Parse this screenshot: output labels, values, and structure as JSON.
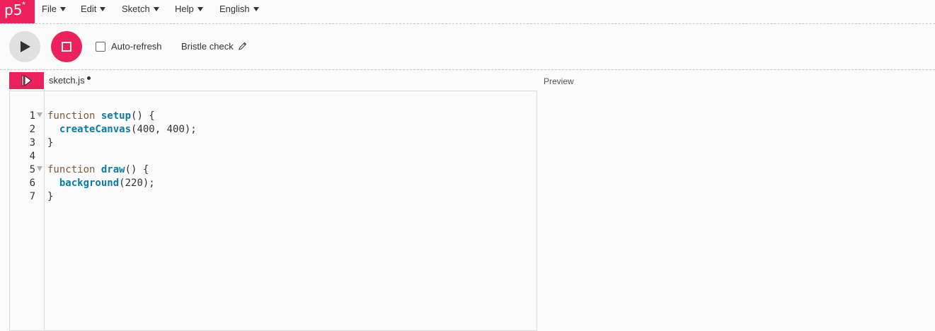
{
  "logo": {
    "text": "p5",
    "mark": "*"
  },
  "menu": [
    {
      "label": "File"
    },
    {
      "label": "Edit"
    },
    {
      "label": "Sketch"
    },
    {
      "label": "Help"
    },
    {
      "label": "English"
    }
  ],
  "toolbar": {
    "auto_refresh_label": "Auto-refresh",
    "auto_refresh_checked": false,
    "sketch_name": "Bristle check"
  },
  "editor": {
    "file_tab": "sketch.js",
    "preview_label": "Preview",
    "lines": [
      {
        "number": "1",
        "keyword": "function ",
        "name": "setup",
        "rest": "() {"
      },
      {
        "number": "2",
        "keyword": "  ",
        "name": "createCanvas",
        "rest": "(400, 400);"
      },
      {
        "number": "3",
        "keyword": "",
        "name": "",
        "rest": "}"
      },
      {
        "number": "4",
        "keyword": "",
        "name": "",
        "rest": ""
      },
      {
        "number": "5",
        "keyword": "function ",
        "name": "draw",
        "rest": "() {"
      },
      {
        "number": "6",
        "keyword": "  ",
        "name": "background",
        "rest": "(220);"
      },
      {
        "number": "7",
        "keyword": "",
        "name": "",
        "rest": "}"
      }
    ]
  },
  "colors": {
    "accent": "#ed225d",
    "keyword": "#7a5a3a",
    "function": "#0b7ca9"
  },
  "icons": [
    "play-icon",
    "stop-icon",
    "pencil-icon",
    "sidebar-toggle-icon",
    "fold-arrow-icon"
  ]
}
